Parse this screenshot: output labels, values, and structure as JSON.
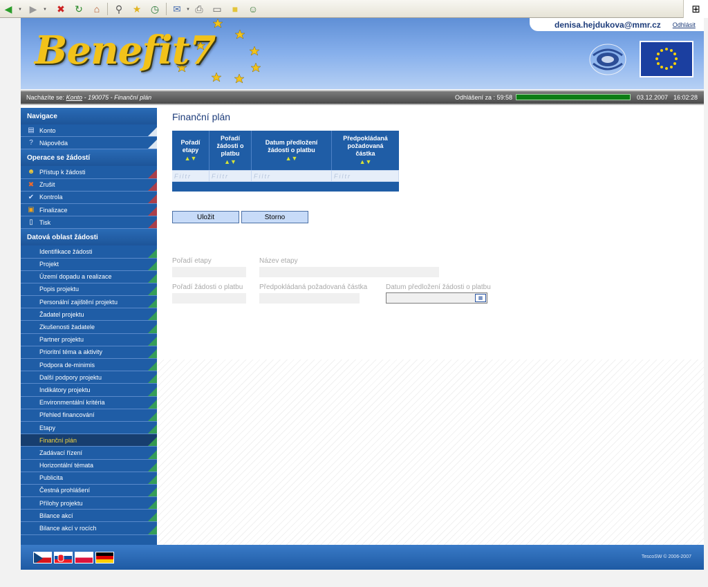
{
  "header": {
    "user_email": "denisa.hejdukova@mmr.cz",
    "logout_label": "Odhlásit",
    "logo_text": "Benefit7"
  },
  "status": {
    "location_label": "Nacházíte se:",
    "crumb_link": "Konto",
    "crumb_rest": " - 190075 - Finanční plán",
    "logout_timer_label": "Odhlášení za : 59:58",
    "date": "03.12.2007",
    "time": "16:02:28"
  },
  "sidebar": {
    "nav_title": "Navigace",
    "nav_items": [
      {
        "label": "Konto",
        "icon": "account-icon"
      },
      {
        "label": "Nápověda",
        "icon": "help-icon"
      }
    ],
    "ops_title": "Operace se žádostí",
    "ops_items": [
      {
        "label": "Přístup k žádosti",
        "icon": "users-icon"
      },
      {
        "label": "Zrušit",
        "icon": "cancel-icon"
      },
      {
        "label": "Kontrola",
        "icon": "check-icon"
      },
      {
        "label": "Finalizace",
        "icon": "lock-icon"
      },
      {
        "label": "Tisk",
        "icon": "print-icon"
      }
    ],
    "data_title": "Datová oblast žádosti",
    "data_items": [
      "Identifikace žádosti",
      "Projekt",
      "Území dopadu a realizace",
      "Popis projektu",
      "Personální zajištění projektu",
      "Žadatel projektu",
      "Zkušenosti žadatele",
      "Partner projektu",
      "Prioritní téma a aktivity",
      "Podpora de-minimis",
      "Další podpory projektu",
      "Indikátory projektu",
      "Environmentální kritéria",
      "Přehled financování",
      "Etapy",
      "Finanční plán",
      "Zadávací řízení",
      "Horizontální témata",
      "Publicita",
      "Čestná prohlášení",
      "Přílohy projektu",
      "Bilance akcí",
      "Bilance akcí v rocích"
    ],
    "active_item": "Finanční plán"
  },
  "main": {
    "title": "Finanční plán",
    "grid": {
      "columns": [
        {
          "line1": "Pořadí",
          "line2": "etapy",
          "line3": ""
        },
        {
          "line1": "Pořadí",
          "line2": "žádosti o",
          "line3": "platbu"
        },
        {
          "line1": "Datum předložení",
          "line2": "žádosti o platbu",
          "line3": ""
        },
        {
          "line1": "Předpokládaná",
          "line2": "požadovaná",
          "line3": "částka"
        }
      ],
      "sort_glyph": "▲▼",
      "filter_placeholder": "Filtr"
    },
    "buttons": {
      "save": "Uložit",
      "cancel": "Storno"
    },
    "form": {
      "stage_order_label": "Pořadí etapy",
      "stage_name_label": "Název etapy",
      "payment_order_label": "Pořadí žádosti o platbu",
      "expected_amount_label": "Předpokládaná požadovaná částka",
      "submission_date_label": "Datum předložení žádosti o platbu"
    }
  },
  "footer": {
    "copyright": "TescoSW © 2006-2007",
    "languages": [
      "cs",
      "sk",
      "pl",
      "de"
    ]
  },
  "colors": {
    "sidebar_blue": "#1f5da6",
    "active_text": "#f3d43f",
    "title_blue": "#1d3c7a",
    "timer_green": "#0b7d14"
  }
}
